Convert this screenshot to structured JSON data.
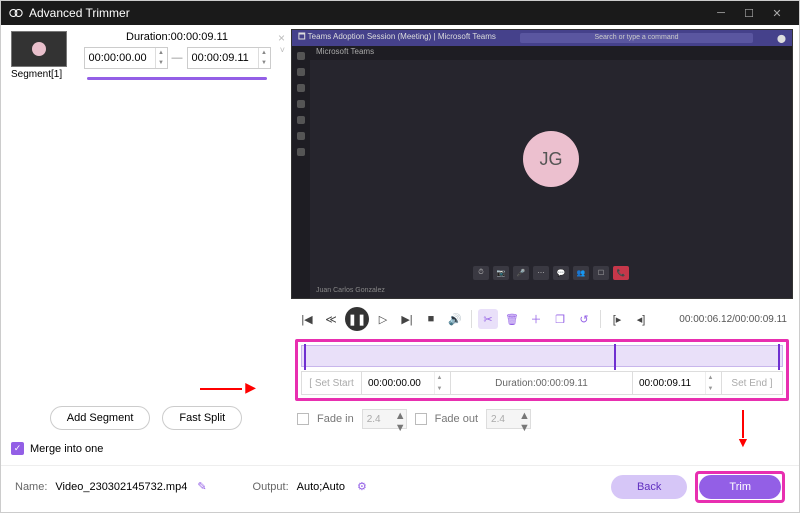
{
  "titlebar": {
    "title": "Advanced Trimmer"
  },
  "segment": {
    "duration_label": "Duration:00:00:09.11",
    "start": "00:00:00.00",
    "end": "00:00:09.11",
    "name": "Segment[1]"
  },
  "buttons": {
    "add_segment": "Add Segment",
    "fast_split": "Fast Split",
    "back": "Back",
    "trim": "Trim"
  },
  "merge": {
    "label": "Merge into one"
  },
  "preview": {
    "teams_app": "Microsoft Teams",
    "search_placeholder": "Search or type a command",
    "avatar_initials": "JG",
    "caller": "Juan Carlos Gonzalez"
  },
  "playback": {
    "time_display": "00:00:06.12/00:00:09.11"
  },
  "trimbar": {
    "set_start": "[  Set Start",
    "start_val": "00:00:00.00",
    "duration": "Duration:00:00:09.11",
    "end_val": "00:00:09.11",
    "set_end": "Set End  ]"
  },
  "fade": {
    "in_label": "Fade in",
    "in_val": "2.4",
    "out_label": "Fade out",
    "out_val": "2.4"
  },
  "footer": {
    "name_label": "Name:",
    "name_value": "Video_230302145732.mp4",
    "output_label": "Output:",
    "output_value": "Auto;Auto"
  }
}
